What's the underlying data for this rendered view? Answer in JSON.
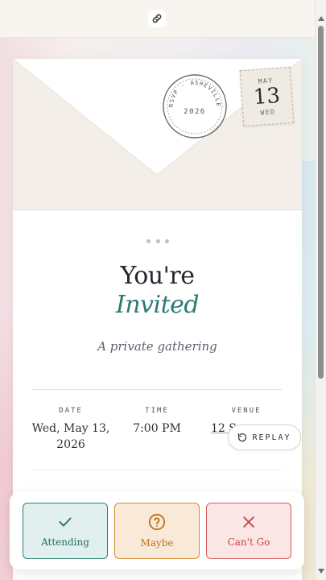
{
  "topbar": {
    "link_icon": "link-icon"
  },
  "envelope": {
    "postmark": {
      "top_text": "RSVP · ASHEVILLE",
      "year": "2026"
    },
    "stamp": {
      "month": "MAY",
      "day": "13",
      "weekday": "WED"
    }
  },
  "hero": {
    "line1": "You're",
    "line2": "Invited",
    "subtitle": "A private gathering"
  },
  "details": {
    "date": {
      "label": "DATE",
      "value_line1": "Wed, May 13,",
      "value_line2": "2026"
    },
    "time": {
      "label": "TIME",
      "value": "7:00 PM"
    },
    "venue": {
      "label": "VENUE",
      "value": "12 S"
    }
  },
  "replay": {
    "label": "REPLAY",
    "icon": "replay-icon"
  },
  "rsvp": {
    "attending": {
      "label": "Attending",
      "icon": "check-icon"
    },
    "maybe": {
      "label": "Maybe",
      "icon": "question-icon"
    },
    "cant_go": {
      "label": "Can't Go",
      "icon": "x-icon"
    }
  },
  "colors": {
    "accent_teal": "#2a7b70",
    "maybe_orange": "#d68a2c",
    "cant_red": "#d85a5a"
  }
}
